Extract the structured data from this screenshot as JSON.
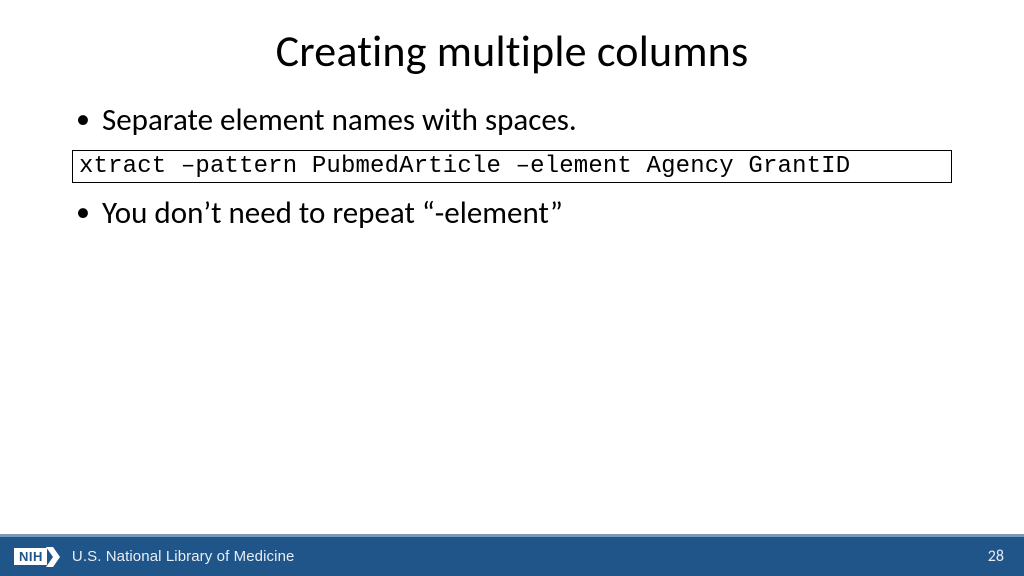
{
  "title": "Creating multiple columns",
  "bullets": [
    "Separate element names with spaces.",
    "You don’t need to repeat “-element”"
  ],
  "code": "xtract –pattern PubmedArticle –element Agency GrantID",
  "footer": {
    "logo_text": "NIH",
    "library": "U.S. National Library of Medicine",
    "page": "28"
  },
  "colors": {
    "footer_bg": "#20558a",
    "footer_border": "#7a99b8"
  }
}
